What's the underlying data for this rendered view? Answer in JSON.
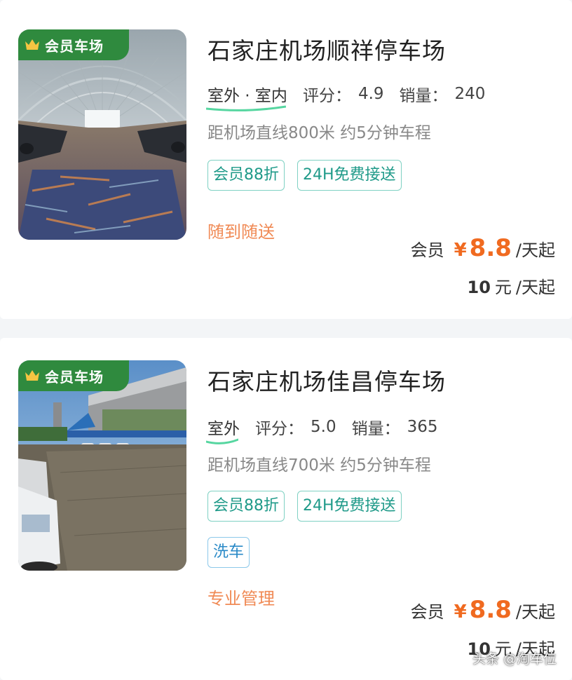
{
  "colors": {
    "badge_bg": "#2f8a3e",
    "price": "#f06a20",
    "feature": "#f08a55",
    "tag_green": "#1f9a89",
    "tag_blue": "#2a8ac7"
  },
  "listings": [
    {
      "badge": "会员车场",
      "name": "石家庄机场顺祥停车场",
      "type": "室外 · 室内",
      "rating_label": "评分：",
      "rating": "4.9",
      "sales_label": "销量：",
      "sales": "240",
      "distance": "距机场直线800米 约5分钟车程",
      "tags": [
        "会员88折",
        "24H免费接送"
      ],
      "feature": "随到随送",
      "member_label": "会员",
      "currency": "¥",
      "member_price": "8.8",
      "per_day": "/天起",
      "base_price": "10",
      "base_currency": "元",
      "base_per_day": "/天起",
      "image": "covered-parking-canopy"
    },
    {
      "badge": "会员车场",
      "name": "石家庄机场佳昌停车场",
      "type": "室外",
      "rating_label": "评分：",
      "rating": "5.0",
      "sales_label": "销量：",
      "sales": "365",
      "distance": "距机场直线700米 约5分钟车程",
      "tags": [
        "会员88折",
        "24H免费接送"
      ],
      "tags_row2": [
        "洗车"
      ],
      "feature": "专业管理",
      "member_label": "会员",
      "currency": "¥",
      "member_price": "8.8",
      "per_day": "/天起",
      "base_price": "10",
      "base_currency": "元",
      "base_per_day": "/天起",
      "image": "outdoor-parking-lot"
    }
  ],
  "watermark": "头条 @淘车位"
}
